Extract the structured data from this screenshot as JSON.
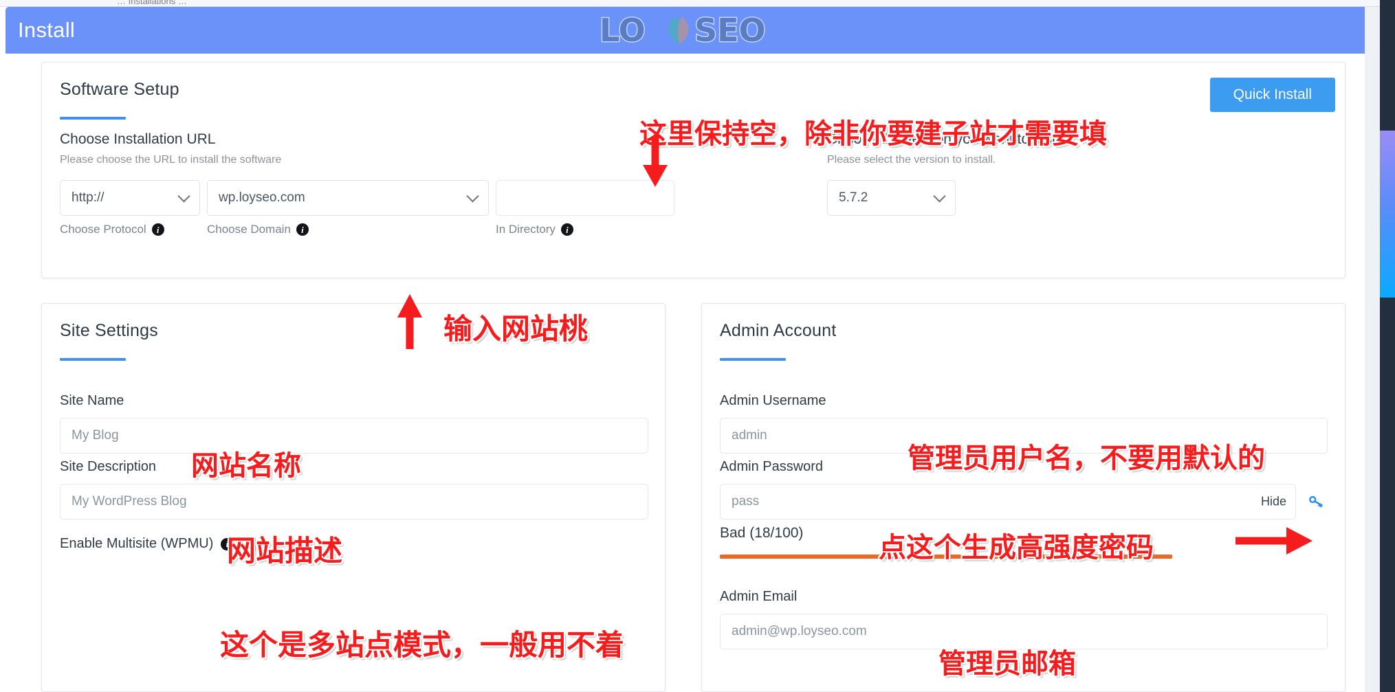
{
  "window": {
    "title": "Install",
    "brand": "LOYSEO",
    "close_label": "✖",
    "background_sliver_text": "… Installations …"
  },
  "software_setup": {
    "title": "Software Setup",
    "quick_install_label": "Quick Install",
    "installation_url": {
      "heading": "Choose Installation URL",
      "subtext": "Please choose the URL to install the software",
      "protocol": {
        "value": "http://",
        "caption": "Choose Protocol"
      },
      "domain": {
        "value": "wp.loyseo.com",
        "caption": "Choose Domain"
      },
      "directory": {
        "value": "",
        "placeholder": "",
        "caption": "In Directory"
      }
    },
    "version": {
      "heading": "Choose the version you want to install",
      "subtext": "Please select the version to install.",
      "value": "5.7.2"
    }
  },
  "site_settings": {
    "title": "Site Settings",
    "site_name": {
      "label": "Site Name",
      "placeholder": "My Blog",
      "value": ""
    },
    "site_description": {
      "label": "Site Description",
      "placeholder": "My WordPress Blog",
      "value": ""
    },
    "multisite": {
      "label": "Enable Multisite (WPMU)",
      "checked": false
    }
  },
  "admin_account": {
    "title": "Admin Account",
    "username": {
      "label": "Admin Username",
      "placeholder": "admin",
      "value": ""
    },
    "password": {
      "label": "Admin Password",
      "placeholder": "pass",
      "value": "",
      "toggle_label": "Hide",
      "generate_icon": "key-icon"
    },
    "strength": {
      "label": "Bad (18/100)",
      "score": 18,
      "max": 100,
      "color": "#ef6723"
    },
    "email": {
      "label": "Admin Email",
      "placeholder": "admin@wp.loyseo.com",
      "value": ""
    }
  },
  "annotations": {
    "directory_note": "这里保持空，除非你要建子站才需要填",
    "domain_note": "输入网站桃",
    "site_name_note": "网站名称",
    "site_desc_note": "网站描述",
    "multisite_note": "这个是多站点模式，一般用不着",
    "username_note": "管理员用户名，不要用默认的",
    "password_note": "点这个生成高强度密码",
    "email_note": "管理员邮箱"
  },
  "colors": {
    "header_blue": "#6b92f8",
    "accent_blue": "#3d92f0",
    "button_blue": "#3b9cf0",
    "annotation_red": "#f41c1c",
    "strength_orange": "#ef6723",
    "scrollbar_track": "#232f3e"
  }
}
